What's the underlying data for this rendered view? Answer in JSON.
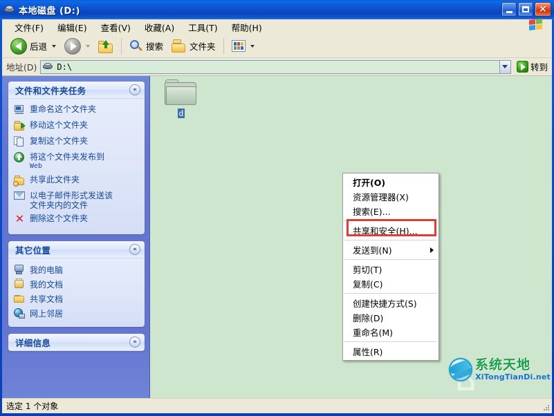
{
  "window": {
    "title": "本地磁盘 (D:)",
    "title_icon": "hard-disk-icon",
    "minimize": "_",
    "maximize": "□",
    "close": "✕"
  },
  "menubar": {
    "items": [
      {
        "label": "文件(F)"
      },
      {
        "label": "编辑(E)"
      },
      {
        "label": "查看(V)"
      },
      {
        "label": "收藏(A)"
      },
      {
        "label": "工具(T)"
      },
      {
        "label": "帮助(H)"
      }
    ]
  },
  "toolbar": {
    "back_label": "后退",
    "forward_label": "",
    "up_label": "",
    "search_label": "搜索",
    "folders_label": "文件夹",
    "views_label": ""
  },
  "address": {
    "label": "地址(D)",
    "value": "D:\\",
    "go_label": "转到"
  },
  "sidebar": {
    "file_tasks": {
      "title": "文件和文件夹任务",
      "collapse_glyph": "«",
      "items": [
        {
          "label": "重命名这个文件夹",
          "icon": "rename-icon"
        },
        {
          "label": "移动这个文件夹",
          "icon": "move-icon"
        },
        {
          "label": "复制这个文件夹",
          "icon": "copy-icon"
        },
        {
          "label": "将这个文件夹发布到",
          "sub": "Web",
          "icon": "publish-web-icon"
        },
        {
          "label": "共享此文件夹",
          "icon": "share-folder-icon"
        },
        {
          "label": "以电子邮件形式发送该",
          "sub": "文件夹内的文件",
          "icon": "mail-icon"
        },
        {
          "label": "删除这个文件夹",
          "icon": "delete-x-icon"
        }
      ]
    },
    "other_places": {
      "title": "其它位置",
      "collapse_glyph": "«",
      "items": [
        {
          "label": "我的电脑",
          "icon": "my-computer-icon"
        },
        {
          "label": "我的文档",
          "icon": "my-documents-icon"
        },
        {
          "label": "共享文档",
          "icon": "shared-documents-icon"
        },
        {
          "label": "网上邻居",
          "icon": "network-places-icon"
        }
      ]
    },
    "details": {
      "title": "详细信息",
      "expand_glyph": "»"
    }
  },
  "content": {
    "folder_name": "d"
  },
  "context_menu": {
    "items": [
      {
        "label": "打开(O)",
        "bold": true,
        "type": "item"
      },
      {
        "label": "资源管理器(X)",
        "type": "item"
      },
      {
        "label": "搜索(E)...",
        "type": "item"
      },
      {
        "type": "separator"
      },
      {
        "label": "共享和安全(H)...",
        "type": "item",
        "highlighted": true
      },
      {
        "type": "separator"
      },
      {
        "label": "发送到(N)",
        "type": "submenu"
      },
      {
        "type": "separator"
      },
      {
        "label": "剪切(T)",
        "type": "item"
      },
      {
        "label": "复制(C)",
        "type": "item"
      },
      {
        "type": "separator"
      },
      {
        "label": "创建快捷方式(S)",
        "type": "item"
      },
      {
        "label": "删除(D)",
        "type": "item"
      },
      {
        "label": "重命名(M)",
        "type": "item"
      },
      {
        "type": "separator"
      },
      {
        "label": "属性(R)",
        "type": "item"
      }
    ],
    "highlight_color": "#e23b32"
  },
  "statusbar": {
    "text": "选定 1 个对象"
  },
  "watermark": {
    "main": "系统天地",
    "sub": "XiTongTianDi.net"
  },
  "colors": {
    "titlebar_blue": "#0a52cb",
    "sidebar_blue": "#6375d0",
    "content_green": "#cde6cd",
    "chrome_beige": "#ece9d8",
    "link_blue": "#16489d",
    "highlight_red": "#e23b32",
    "watermark_green": "#1aa04a"
  }
}
